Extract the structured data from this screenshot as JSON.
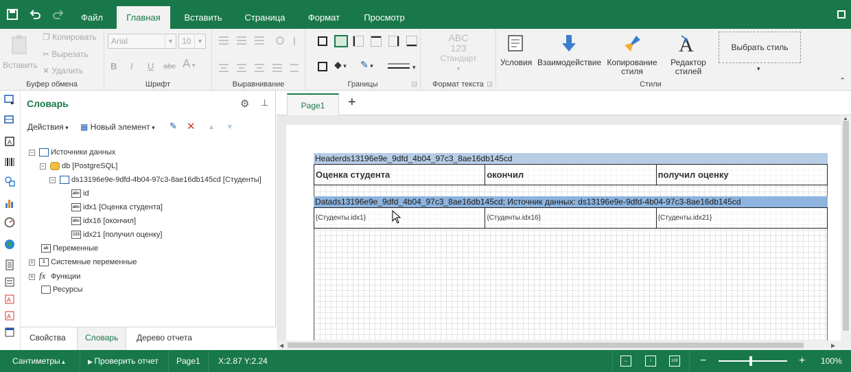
{
  "ribbon_tabs": [
    "Файл",
    "Главная",
    "Вставить",
    "Страница",
    "Формат",
    "Просмотр"
  ],
  "clipboard": {
    "paste": "Вставить",
    "copy": "Копировать",
    "cut": "Вырезать",
    "delete": "Удалить",
    "label": "Буфер обмена"
  },
  "font": {
    "family": "Arial",
    "size": "10",
    "bold": "B",
    "italic": "I",
    "underline": "U",
    "strike": "abc",
    "color": "A",
    "label": "Шрифт"
  },
  "alignment": {
    "label": "Выравнивание"
  },
  "borders": {
    "label": "Границы"
  },
  "text_format": {
    "sample_top": "ABC",
    "sample_bottom": "123",
    "standard": "Стандарт",
    "label": "Формат текста"
  },
  "styles": {
    "conditions": "Условия",
    "interaction": "Взаимодействие",
    "copy_style_1": "Копирование",
    "copy_style_2": "стиля",
    "editor_1": "Редактор",
    "editor_2": "стилей",
    "choose_style": "Выбрать стиль",
    "label": "Стили"
  },
  "dictionary": {
    "title": "Словарь",
    "actions": "Действия",
    "new_item": "Новый элемент",
    "tree": {
      "data_sources": "Источники данных",
      "db": "db [PostgreSQL]",
      "ds": "ds13196e9e-9dfd-4b04-97c3-8ae16db145cd [Студенты]",
      "col_id": "id",
      "col_idx1": "idx1 [Оценка студента]",
      "col_idx16": "idx16 [окончил]",
      "col_idx21": "idx21 [получил оценку]",
      "variables": "Переменные",
      "system_variables": "Системные переменные",
      "functions": "Функции",
      "resources": "Ресурсы"
    },
    "icons": {
      "abc": "abc",
      "num": "123"
    },
    "tabs": [
      "Свойства",
      "Словарь",
      "Дерево отчета"
    ]
  },
  "page_tab": "Page1",
  "report": {
    "header_band": "Headerds13196e9e_9dfd_4b04_97c3_8ae16db145cd",
    "header_cells": [
      "Оценка студента",
      "окончил",
      "получил оценку"
    ],
    "data_band": "Datads13196e9e_9dfd_4b04_97c3_8ae16db145cd; Источник данных: ds13196e9e-9dfd-4b04-97c3-8ae16db145cd",
    "data_cells": [
      "{Студенты.idx1}",
      "{Студенты.idx16}",
      "{Студенты.idx21}"
    ]
  },
  "status": {
    "units": "Сантиметры",
    "check": "Проверить отчет",
    "page": "Page1",
    "coords": "X:2.87 Y:2.24",
    "zoom_minus": "−",
    "zoom_plus": "+",
    "zoom": "100%"
  },
  "colors": {
    "brand": "#19784a",
    "header_band": "#b7cde6",
    "data_band": "#8db4de"
  }
}
